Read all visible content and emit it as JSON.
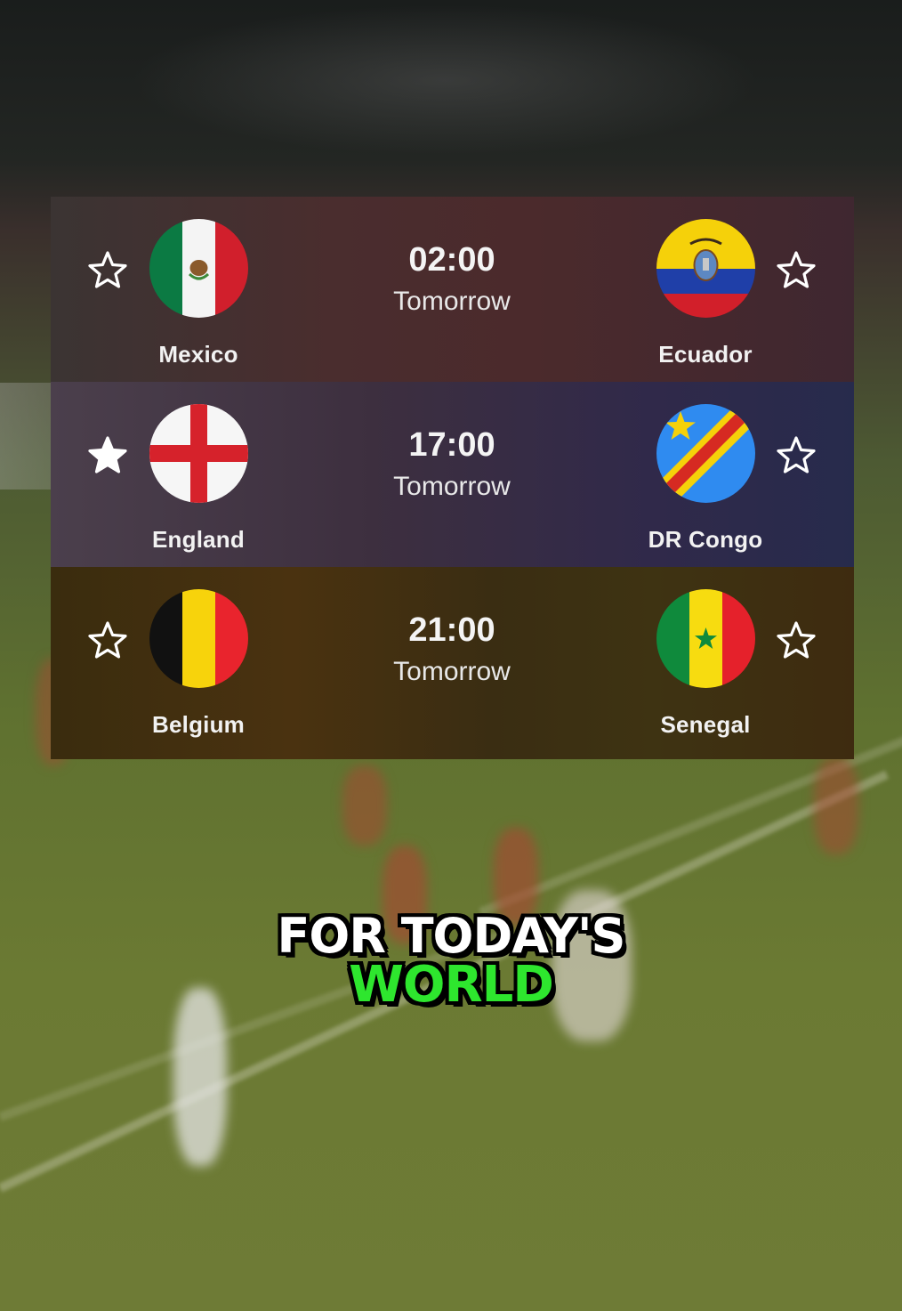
{
  "matches": [
    {
      "home": {
        "name": "Mexico",
        "flag": "mexico-flag",
        "favorite": false
      },
      "away": {
        "name": "Ecuador",
        "flag": "ecuador-flag",
        "favorite": false
      },
      "time": "02:00",
      "day": "Tomorrow"
    },
    {
      "home": {
        "name": "England",
        "flag": "england-flag",
        "favorite": true
      },
      "away": {
        "name": "DR Congo",
        "flag": "dr-congo-flag",
        "favorite": false
      },
      "time": "17:00",
      "day": "Tomorrow"
    },
    {
      "home": {
        "name": "Belgium",
        "flag": "belgium-flag",
        "favorite": false
      },
      "away": {
        "name": "Senegal",
        "flag": "senegal-flag",
        "favorite": false
      },
      "time": "21:00",
      "day": "Tomorrow"
    }
  ],
  "caption": {
    "line1": "FOR TODAY'S",
    "line2": "WORLD"
  },
  "colors": {
    "caption_highlight": "#2ee62e",
    "caption_text": "#ffffff"
  }
}
